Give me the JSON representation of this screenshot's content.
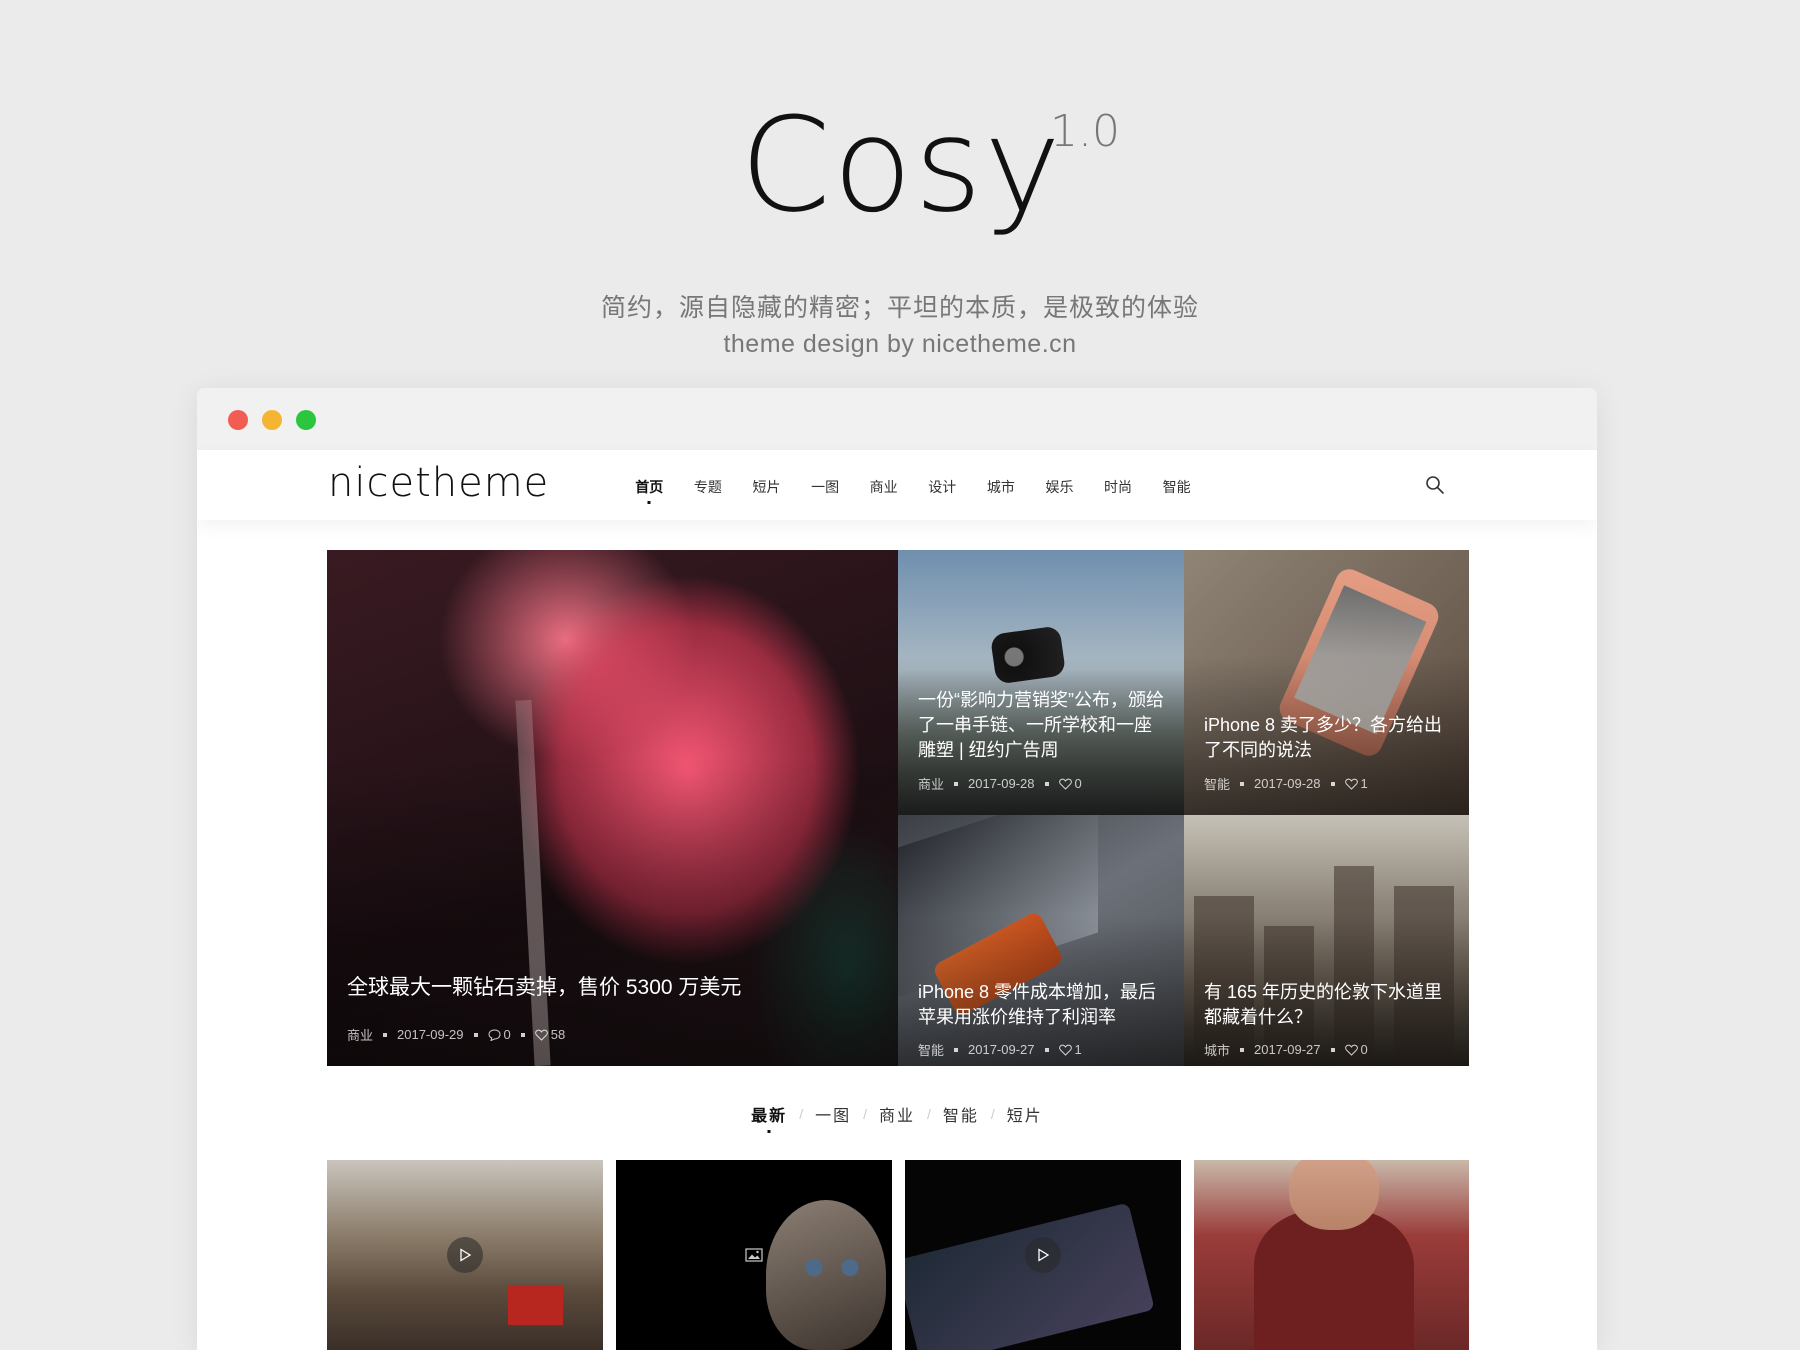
{
  "hero": {
    "title": "Cosy",
    "version": "1.0",
    "tagline": "简约，源自隐藏的精密；平坦的本质，是极致的体验",
    "credit": "theme design by nicetheme.cn"
  },
  "window": {
    "controls": [
      "close",
      "minimize",
      "maximize"
    ]
  },
  "nav": {
    "logo": "nicetheme",
    "items": [
      {
        "label": "首页",
        "active": true
      },
      {
        "label": "专题"
      },
      {
        "label": "短片"
      },
      {
        "label": "一图"
      },
      {
        "label": "商业"
      },
      {
        "label": "设计"
      },
      {
        "label": "城市"
      },
      {
        "label": "娱乐"
      },
      {
        "label": "时尚"
      },
      {
        "label": "智能"
      }
    ],
    "search_icon": "search-icon"
  },
  "featured": {
    "main": {
      "title": "全球最大一颗钻石卖掉，售价 5300 万美元",
      "category": "商业",
      "date": "2017-09-29",
      "comments": "0",
      "likes": "58"
    },
    "side": [
      {
        "title": "一份“影响力营销奖”公布，颁给了一串手链、一所学校和一座雕塑 | 纽约广告周",
        "category": "商业",
        "date": "2017-09-28",
        "likes": "0"
      },
      {
        "title": "iPhone 8 卖了多少？各方给出了不同的说法",
        "category": "智能",
        "date": "2017-09-28",
        "likes": "1"
      },
      {
        "title": "iPhone 8 零件成本增加，最后苹果用涨价维持了利润率",
        "category": "智能",
        "date": "2017-09-27",
        "likes": "1"
      },
      {
        "title": "有 165 年历史的伦敦下水道里都藏着什么？",
        "category": "城市",
        "date": "2017-09-27",
        "likes": "0"
      }
    ]
  },
  "tabs": [
    {
      "label": "最新",
      "active": true
    },
    {
      "label": "一图"
    },
    {
      "label": "商业"
    },
    {
      "label": "智能"
    },
    {
      "label": "短片"
    }
  ],
  "thumbs": [
    {
      "icon": "play-icon"
    },
    {
      "icon": "image-icon"
    },
    {
      "icon": "play-icon"
    },
    {
      "icon": ""
    }
  ]
}
